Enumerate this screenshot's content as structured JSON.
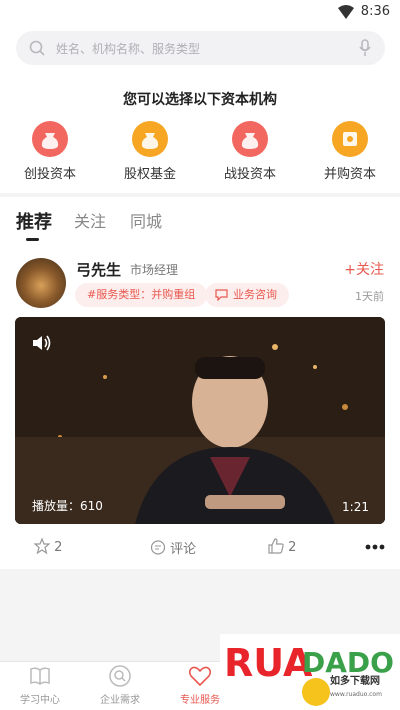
{
  "status": {
    "time": "8:36"
  },
  "search": {
    "placeholder": "姓名、机构名称、服务类型"
  },
  "section_title": "您可以选择以下资本机构",
  "categories": [
    {
      "label": "创投资本",
      "color": "#f26860"
    },
    {
      "label": "股权基金",
      "color": "#f6a623"
    },
    {
      "label": "战投资本",
      "color": "#f26860"
    },
    {
      "label": "并购资本",
      "color": "#f6a623"
    }
  ],
  "tabs": [
    "推荐",
    "关注",
    "同城"
  ],
  "post": {
    "name": "弓先生",
    "role": "市场经理",
    "follow": "+关注",
    "chip1": "#服务类型：并购重组",
    "chip2": "业务咨询",
    "time": "1天前",
    "video": {
      "views": "播放量：610",
      "duration": "1:21"
    },
    "actions": {
      "likes": "2",
      "comment": "评论",
      "thumbs": "2"
    }
  },
  "tabbar": [
    {
      "label": "学习中心",
      "active": false
    },
    {
      "label": "企业需求",
      "active": false
    },
    {
      "label": "专业服务",
      "active": true
    }
  ],
  "watermark": {
    "logo": "RUANDADO",
    "cn": "如多下载网",
    "url": "www.ruaduo.com"
  },
  "colors": {
    "accent": "#e8584f",
    "orange": "#f6a623"
  }
}
